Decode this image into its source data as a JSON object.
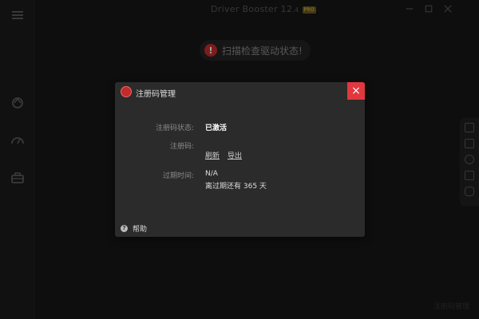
{
  "app": {
    "title": "Driver Booster 12",
    "version_suffix": ".4",
    "badge": "PRO",
    "footer_link": "注册码管理"
  },
  "scan_banner": {
    "icon_text": "!",
    "text": "扫描检查驱动状态!"
  },
  "sidebar": {
    "items": [
      {
        "icon": "menu-icon"
      },
      {
        "icon": "scan-icon"
      },
      {
        "icon": "speedometer-icon"
      },
      {
        "icon": "toolbox-icon"
      }
    ]
  },
  "right_rail": {
    "items": [
      {
        "icon": "chat-icon"
      },
      {
        "icon": "windows-icon"
      },
      {
        "icon": "settings-icon"
      },
      {
        "icon": "shield-icon"
      },
      {
        "icon": "gamepad-icon"
      }
    ]
  },
  "dialog": {
    "title": "注册码管理",
    "close_label": "×",
    "status_label": "注册码状态:",
    "status_value": "已激活",
    "code_label": "注册码:",
    "refresh_link": "刷新",
    "export_link": "导出",
    "expiry_label": "过期时间:",
    "expiry_value": "N/A",
    "remaining_text": "离过期还有 365 天",
    "help_icon": "?",
    "help_label": "帮助"
  },
  "colors": {
    "accent_red": "#e0383e",
    "dialog_bg": "#2b2b2b",
    "app_bg": "#161616"
  }
}
